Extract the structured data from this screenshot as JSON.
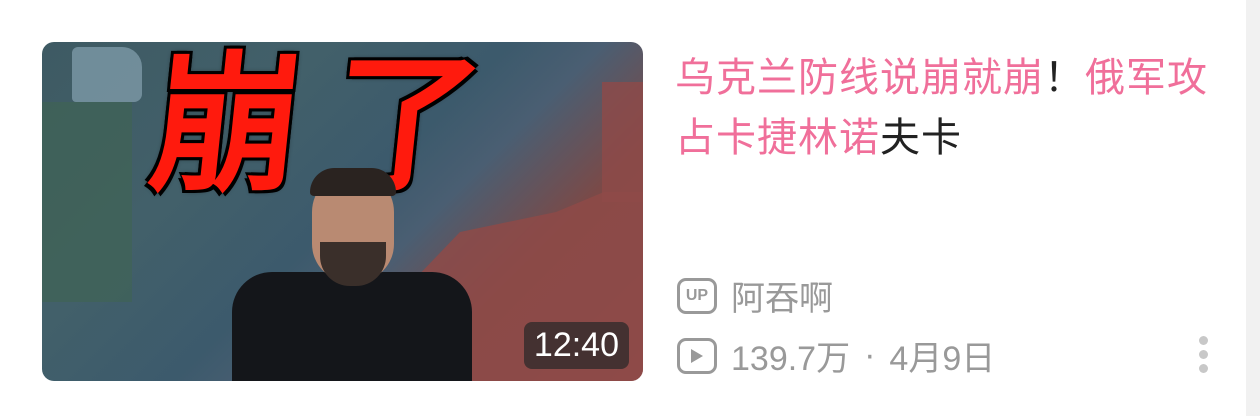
{
  "video": {
    "thumbnail_caption": "崩了",
    "duration": "12:40",
    "title_segments": [
      {
        "text": "乌克兰防线说崩就崩",
        "highlight": true
      },
      {
        "text": "！",
        "highlight": false
      },
      {
        "text": "俄军攻占卡捷林诺",
        "highlight": true
      },
      {
        "text": "夫卡",
        "highlight": false
      }
    ],
    "up_badge": "UP",
    "uploader": "阿吞啊",
    "views": "139.7万",
    "separator": "·",
    "date": "4月9日"
  },
  "colors": {
    "highlight": "#f06f9a",
    "meta": "#999999"
  }
}
